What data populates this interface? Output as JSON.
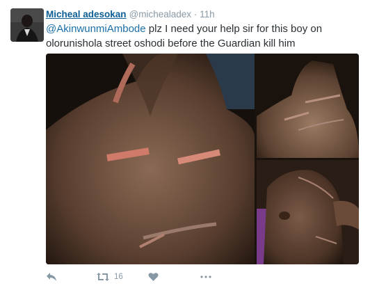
{
  "tweet": {
    "author_name": "Micheal adesokan",
    "author_handle": "@michealadex",
    "separator": "·",
    "time": "11h",
    "mention": "@AkinwunmiAmbode",
    "text_rest": " plz I need your help sir for this boy on olorunishola street oshodi before the Guardian kill him",
    "retweet_count": "16"
  },
  "icons": [
    "reply-icon",
    "retweet-icon",
    "like-icon",
    "more-icon"
  ],
  "colors": {
    "name": "#0b5e95",
    "link": "#1b6fa8",
    "muted": "#8899a6",
    "text": "#292f33"
  }
}
